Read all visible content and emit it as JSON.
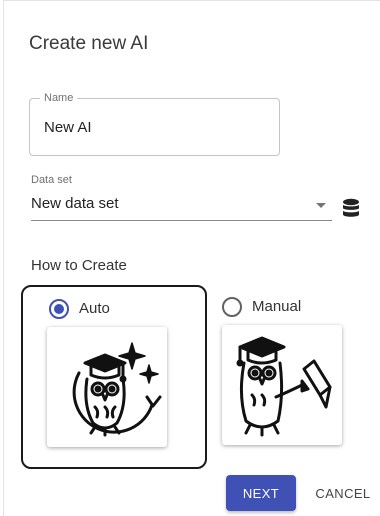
{
  "dialog": {
    "title": "Create new AI",
    "name_field": {
      "label": "Name",
      "value": "New AI"
    },
    "dataset_field": {
      "label": "Data set",
      "value": "New data set",
      "icon": "database-icon"
    },
    "how_to_create": {
      "label": "How to Create",
      "options": [
        {
          "label": "Auto",
          "selected": true,
          "icon": "owl-graduate-sparkle-icon"
        },
        {
          "label": "Manual",
          "selected": false,
          "icon": "owl-graduate-pencil-icon"
        }
      ]
    },
    "actions": {
      "next_label": "NEXT",
      "cancel_label": "CANCEL"
    }
  },
  "colors": {
    "primary": "#3f51b5",
    "selection_border": "#1a1a1a"
  }
}
